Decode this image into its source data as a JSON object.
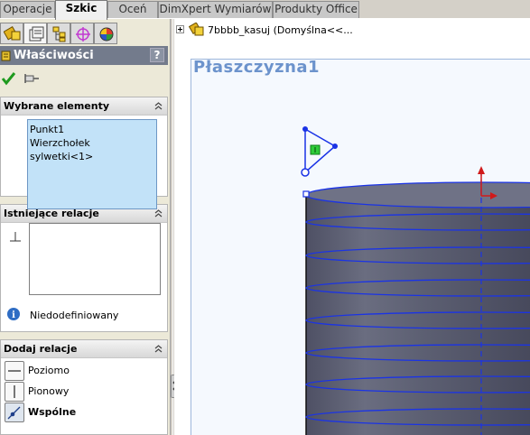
{
  "tabs": [
    {
      "label": "Operacje",
      "active": false
    },
    {
      "label": "Szkic",
      "active": true
    },
    {
      "label": "Oceń",
      "active": false
    },
    {
      "label": "DimXpert Wymiarów",
      "active": false
    },
    {
      "label": "Produkty Office",
      "active": false
    }
  ],
  "panel": {
    "title": "Właściwości",
    "help_label": "?",
    "ok_icon": "green-checkmark-icon",
    "pin_icon": "pushpin-icon"
  },
  "selected": {
    "header": "Wybrane elementy",
    "items": [
      "Punkt1",
      "Wierzchołek sylwetki<1>"
    ]
  },
  "existing": {
    "header": "Istniejące relacje",
    "status": "Niedodefiniowany"
  },
  "add": {
    "header": "Dodaj relacje",
    "items": [
      {
        "label": "Poziomo",
        "bold": false
      },
      {
        "label": "Pionowy",
        "bold": false
      },
      {
        "label": "Wspólne",
        "bold": true
      }
    ]
  },
  "graphics": {
    "tree_item": "7bbbb_kasuj  (Domyślna<<...",
    "plane_label": "Płaszczyzna1"
  },
  "colors": {
    "header_bg": "#737b8c",
    "plane_text": "#6c93cc",
    "highlight_blue": "#1a33e6",
    "cylinder": "#5d6072"
  }
}
